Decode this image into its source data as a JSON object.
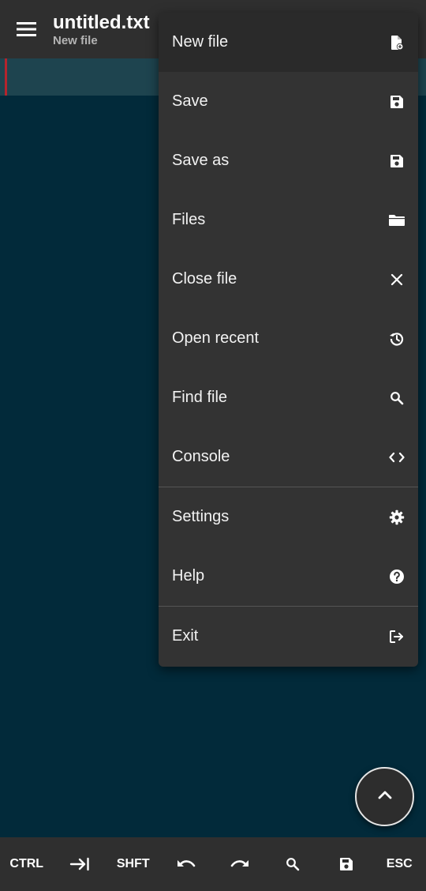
{
  "header": {
    "title": "untitled.txt",
    "subtitle": "New file",
    "menu_icon": "hamburger-menu-icon"
  },
  "menu": {
    "items": [
      {
        "label": "New file",
        "icon": "new-file-icon"
      },
      {
        "label": "Save",
        "icon": "save-icon"
      },
      {
        "label": "Save as",
        "icon": "save-as-icon"
      },
      {
        "label": "Files",
        "icon": "folder-icon"
      },
      {
        "label": "Close file",
        "icon": "close-icon"
      },
      {
        "label": "Open recent",
        "icon": "history-icon"
      },
      {
        "label": "Find file",
        "icon": "search-icon"
      },
      {
        "label": "Console",
        "icon": "code-icon"
      },
      {
        "label": "Settings",
        "icon": "gear-icon"
      },
      {
        "label": "Help",
        "icon": "help-icon"
      },
      {
        "label": "Exit",
        "icon": "exit-icon"
      }
    ]
  },
  "fab": {
    "icon": "chevron-up-icon"
  },
  "toolbar": {
    "ctrl": "CTRL",
    "tab_icon": "tab-icon",
    "shft": "SHFT",
    "undo_icon": "undo-icon",
    "redo_icon": "redo-icon",
    "search_icon": "search-icon",
    "save_icon": "save-icon",
    "esc": "ESC"
  },
  "colors": {
    "editor_background": "#022a3a",
    "current_line": "#1e444f",
    "cursor_marker": "#b3242d",
    "menu_background": "#333333",
    "header_background": "#2f2f2f"
  }
}
